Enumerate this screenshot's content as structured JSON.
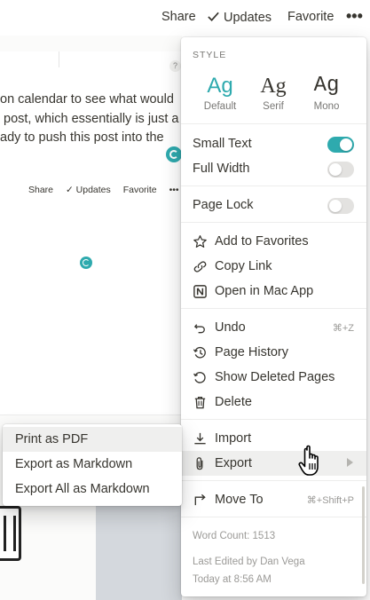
{
  "topbar": {
    "share": "Share",
    "updates": "Updates",
    "favorite": "Favorite",
    "more": "•••"
  },
  "background": {
    "text_lines": [
      "on calendar to see what would",
      " post, which essentially is just a",
      "ady to push this post into the"
    ],
    "help": "?",
    "mini_bar": {
      "share": "Share",
      "updates": "✓ Updates",
      "favorite": "Favorite",
      "more": "•••"
    }
  },
  "menu": {
    "style_label": "STYLE",
    "styles": [
      {
        "glyph": "Ag",
        "name": "Default",
        "selected": true
      },
      {
        "glyph": "Ag",
        "name": "Serif",
        "selected": false
      },
      {
        "glyph": "Ag",
        "name": "Mono",
        "selected": false
      }
    ],
    "toggles": [
      {
        "label": "Small Text",
        "on": true
      },
      {
        "label": "Full Width",
        "on": false
      },
      {
        "label": "Page Lock",
        "on": false
      }
    ],
    "page_actions": [
      {
        "label": "Add to Favorites",
        "icon": "star-icon"
      },
      {
        "label": "Copy Link",
        "icon": "link-icon"
      },
      {
        "label": "Open in Mac App",
        "icon": "notion-app-icon"
      }
    ],
    "history_actions": [
      {
        "label": "Undo",
        "icon": "undo-icon",
        "shortcut": "⌘+Z"
      },
      {
        "label": "Page History",
        "icon": "history-icon",
        "shortcut": ""
      },
      {
        "label": "Show Deleted Pages",
        "icon": "restore-icon",
        "shortcut": ""
      },
      {
        "label": "Delete",
        "icon": "trash-icon",
        "shortcut": ""
      }
    ],
    "io_actions": [
      {
        "label": "Import",
        "icon": "import-icon"
      },
      {
        "label": "Export",
        "icon": "paperclip-icon",
        "has_submenu": true
      }
    ],
    "move_to": {
      "label": "Move To",
      "icon": "move-to-icon",
      "shortcut": "⌘+Shift+P"
    },
    "word_count": "Word Count: 1513",
    "last_edited_by": "Last Edited by Dan Vega",
    "last_edited_at": "Today at 8:56 AM"
  },
  "submenu": {
    "items": [
      {
        "label": "Print as PDF"
      },
      {
        "label": "Export as Markdown"
      },
      {
        "label": "Export All as Markdown"
      }
    ]
  },
  "colors": {
    "accent": "#2eaaae",
    "text": "#37352f",
    "muted": "#9b9a97",
    "hover": "#efefee"
  }
}
